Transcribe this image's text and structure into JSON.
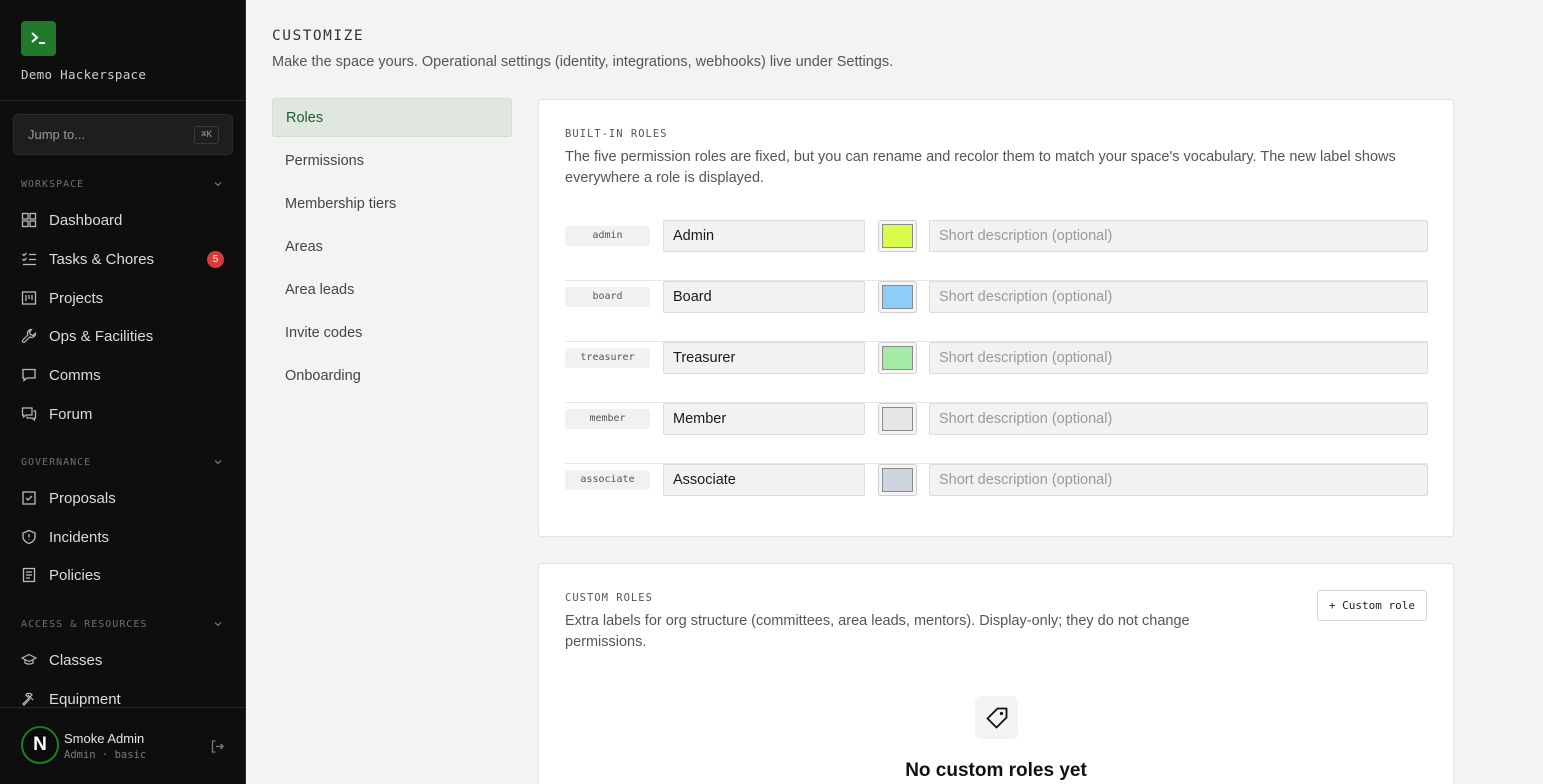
{
  "sidebar": {
    "brand": "Demo Hackerspace",
    "jump_placeholder": "Jump to...",
    "jump_shortcut": "⌘K",
    "sections": [
      {
        "title": "WORKSPACE",
        "items": [
          {
            "label": "Dashboard",
            "icon": "dashboard-icon"
          },
          {
            "label": "Tasks & Chores",
            "icon": "tasks-icon",
            "badge": "5"
          },
          {
            "label": "Projects",
            "icon": "projects-icon"
          },
          {
            "label": "Ops & Facilities",
            "icon": "wrench-icon"
          },
          {
            "label": "Comms",
            "icon": "chat-icon"
          },
          {
            "label": "Forum",
            "icon": "forum-icon"
          }
        ]
      },
      {
        "title": "GOVERNANCE",
        "items": [
          {
            "label": "Proposals",
            "icon": "proposals-icon"
          },
          {
            "label": "Incidents",
            "icon": "shield-icon"
          },
          {
            "label": "Policies",
            "icon": "document-icon"
          }
        ]
      },
      {
        "title": "ACCESS & RESOURCES",
        "items": [
          {
            "label": "Classes",
            "icon": "graduation-cap-icon"
          },
          {
            "label": "Equipment",
            "icon": "hammer-icon"
          }
        ]
      }
    ],
    "user": {
      "initial": "N",
      "name": "Smoke Admin",
      "role": "Admin · basic"
    }
  },
  "header": {
    "title": "CUSTOMIZE",
    "subtitle": "Make the space yours. Operational settings (identity, integrations, webhooks) live under Settings."
  },
  "subnav": [
    "Roles",
    "Permissions",
    "Membership tiers",
    "Areas",
    "Area leads",
    "Invite codes",
    "Onboarding"
  ],
  "builtin": {
    "label": "BUILT-IN ROLES",
    "description": "The five permission roles are fixed, but you can rename and recolor them to match your space's vocabulary. The new label shows everywhere a role is displayed.",
    "description_placeholder": "Short description (optional)",
    "roles": [
      {
        "key": "admin",
        "name": "Admin",
        "color": "#d9fb4c"
      },
      {
        "key": "board",
        "name": "Board",
        "color": "#8ecdf7"
      },
      {
        "key": "treasurer",
        "name": "Treasurer",
        "color": "#a5eaa5"
      },
      {
        "key": "member",
        "name": "Member",
        "color": "#e5e5e5"
      },
      {
        "key": "associate",
        "name": "Associate",
        "color": "#cdd5df"
      }
    ]
  },
  "custom": {
    "label": "CUSTOM ROLES",
    "description": "Extra labels for org structure (committees, area leads, mentors). Display-only; they do not change permissions.",
    "add_button": "+ Custom role",
    "empty_title": "No custom roles yet",
    "empty_icon": "tag-icon"
  }
}
